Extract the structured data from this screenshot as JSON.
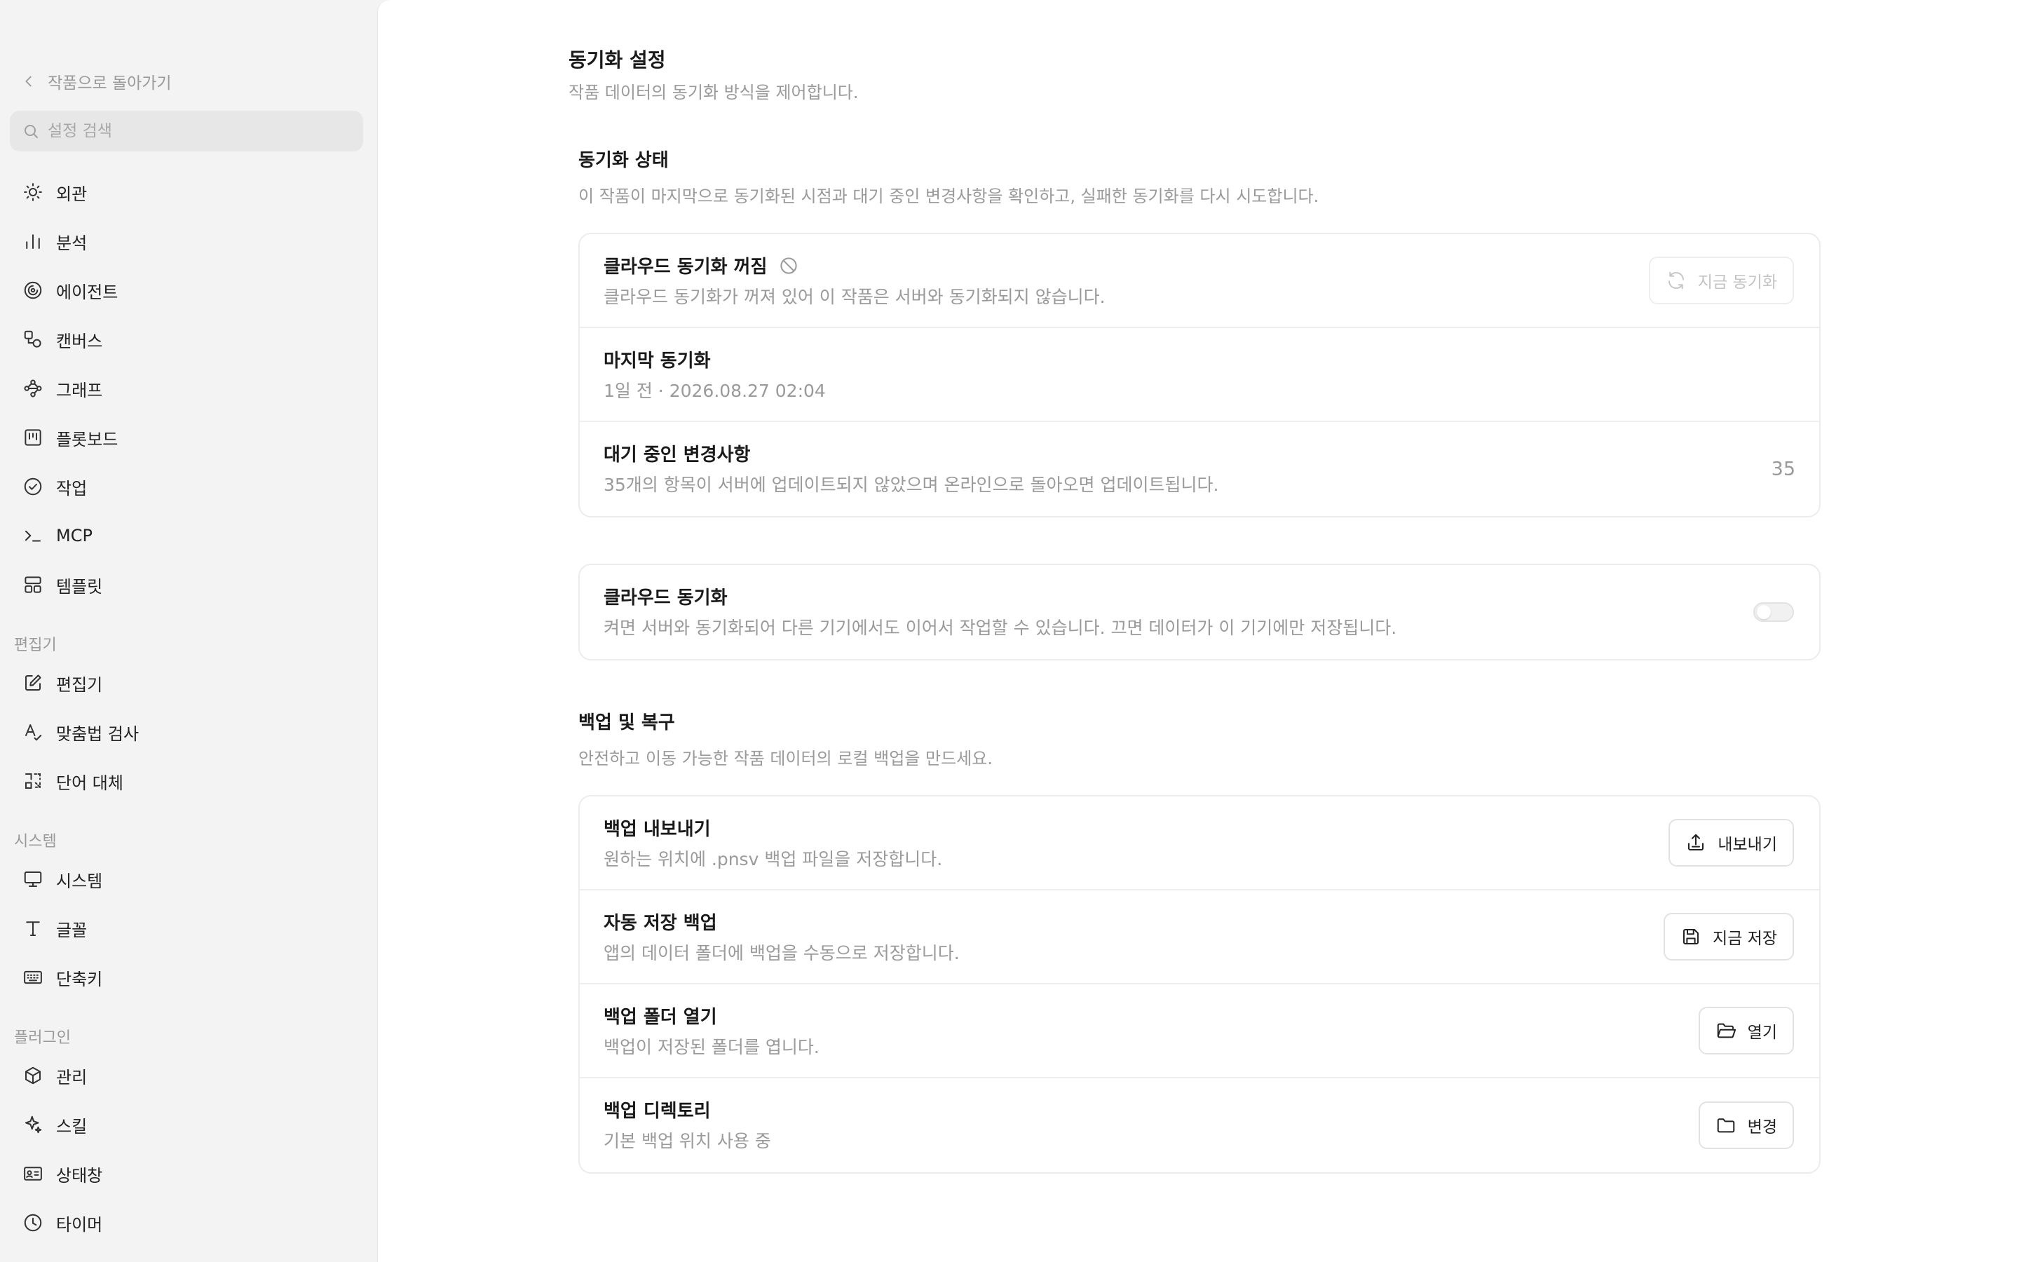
{
  "sidebar": {
    "back_label": "작품으로 돌아가기",
    "search_placeholder": "설정 검색",
    "items": [
      {
        "label": "외관",
        "icon": "sun-icon"
      },
      {
        "label": "분석",
        "icon": "bar-chart-icon"
      },
      {
        "label": "에이전트",
        "icon": "spiral-icon"
      },
      {
        "label": "캔버스",
        "icon": "shapes-icon"
      },
      {
        "label": "그래프",
        "icon": "graph-icon"
      },
      {
        "label": "플롯보드",
        "icon": "board-icon"
      },
      {
        "label": "작업",
        "icon": "check-circle-icon"
      },
      {
        "label": "MCP",
        "icon": "terminal-icon"
      },
      {
        "label": "템플릿",
        "icon": "template-icon"
      }
    ],
    "sections": [
      {
        "label": "편집기",
        "items": [
          {
            "label": "편집기",
            "icon": "edit-icon"
          },
          {
            "label": "맞춤법 검사",
            "icon": "spellcheck-icon"
          },
          {
            "label": "단어 대체",
            "icon": "replace-icon"
          }
        ]
      },
      {
        "label": "시스템",
        "items": [
          {
            "label": "시스템",
            "icon": "monitor-icon"
          },
          {
            "label": "글꼴",
            "icon": "type-icon"
          },
          {
            "label": "단축키",
            "icon": "keyboard-icon"
          }
        ]
      },
      {
        "label": "플러그인",
        "items": [
          {
            "label": "관리",
            "icon": "package-icon"
          },
          {
            "label": "스킬",
            "icon": "sparkle-icon"
          },
          {
            "label": "상태창",
            "icon": "id-card-icon"
          },
          {
            "label": "타이머",
            "icon": "clock-icon"
          }
        ]
      }
    ]
  },
  "page": {
    "title": "동기화 설정",
    "description": "작품 데이터의 동기화 방식을 제어합니다."
  },
  "sync_status": {
    "title": "동기화 상태",
    "description": "이 작품이 마지막으로 동기화된 시점과 대기 중인 변경사항을 확인하고, 실패한 동기화를 다시 시도합니다.",
    "cloud_off": {
      "title": "클라우드 동기화 꺼짐",
      "description": "클라우드 동기화가 꺼져 있어 이 작품은 서버와 동기화되지 않습니다.",
      "button": "지금 동기화"
    },
    "last_sync": {
      "title": "마지막 동기화",
      "value": "1일 전 · 2026.08.27 02:04"
    },
    "pending": {
      "title": "대기 중인 변경사항",
      "description": "35개의 항목이 서버에 업데이트되지 않았으며 온라인으로 돌아오면 업데이트됩니다.",
      "count": "35"
    }
  },
  "cloud_sync": {
    "title": "클라우드 동기화",
    "description": "켜면 서버와 동기화되어 다른 기기에서도 이어서 작업할 수 있습니다. 끄면 데이터가 이 기기에만 저장됩니다.",
    "enabled": false
  },
  "backup": {
    "title": "백업 및 복구",
    "description": "안전하고 이동 가능한 작품 데이터의 로컬 백업을 만드세요.",
    "rows": [
      {
        "title": "백업 내보내기",
        "description": "원하는 위치에 .pnsv 백업 파일을 저장합니다.",
        "button": "내보내기",
        "icon": "export-icon"
      },
      {
        "title": "자동 저장 백업",
        "description": "앱의 데이터 폴더에 백업을 수동으로 저장합니다.",
        "button": "지금 저장",
        "icon": "save-icon"
      },
      {
        "title": "백업 폴더 열기",
        "description": "백업이 저장된 폴더를 엽니다.",
        "button": "열기",
        "icon": "folder-open-icon"
      },
      {
        "title": "백업 디렉토리",
        "description": "기본 백업 위치 사용 중",
        "button": "변경",
        "icon": "folder-icon"
      }
    ]
  }
}
